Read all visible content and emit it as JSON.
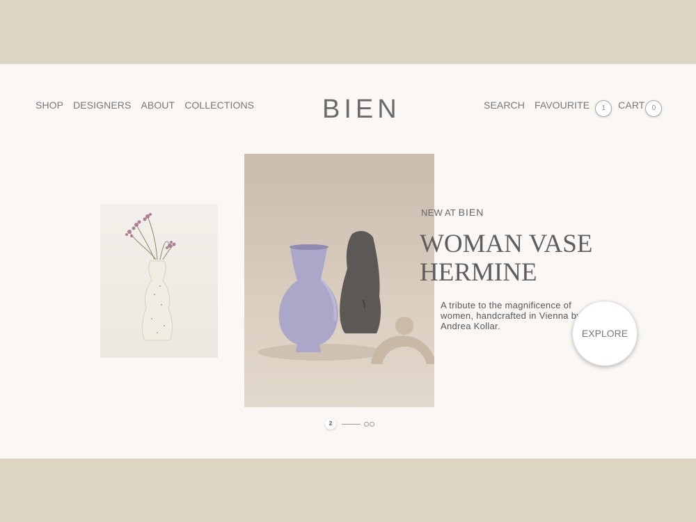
{
  "nav": {
    "left": [
      "SHOP",
      "DESIGNERS",
      "ABOUT",
      "COLLECTIONS"
    ],
    "logo": "BIEN",
    "search": "SEARCH",
    "favourite": "FAVOURITE",
    "favourite_count": "1",
    "cart": "CART",
    "cart_count": "0"
  },
  "hero": {
    "eyebrow_prefix": "NEW AT",
    "eyebrow_brand": "BIEN",
    "headline": "WOMAN VASE\nHERMINE",
    "description": "A tribute to the magnificence of women, handcrafted in Vienna by Andrea Kollar.",
    "explore": "EXPLORE"
  },
  "pager": {
    "current": "2"
  }
}
